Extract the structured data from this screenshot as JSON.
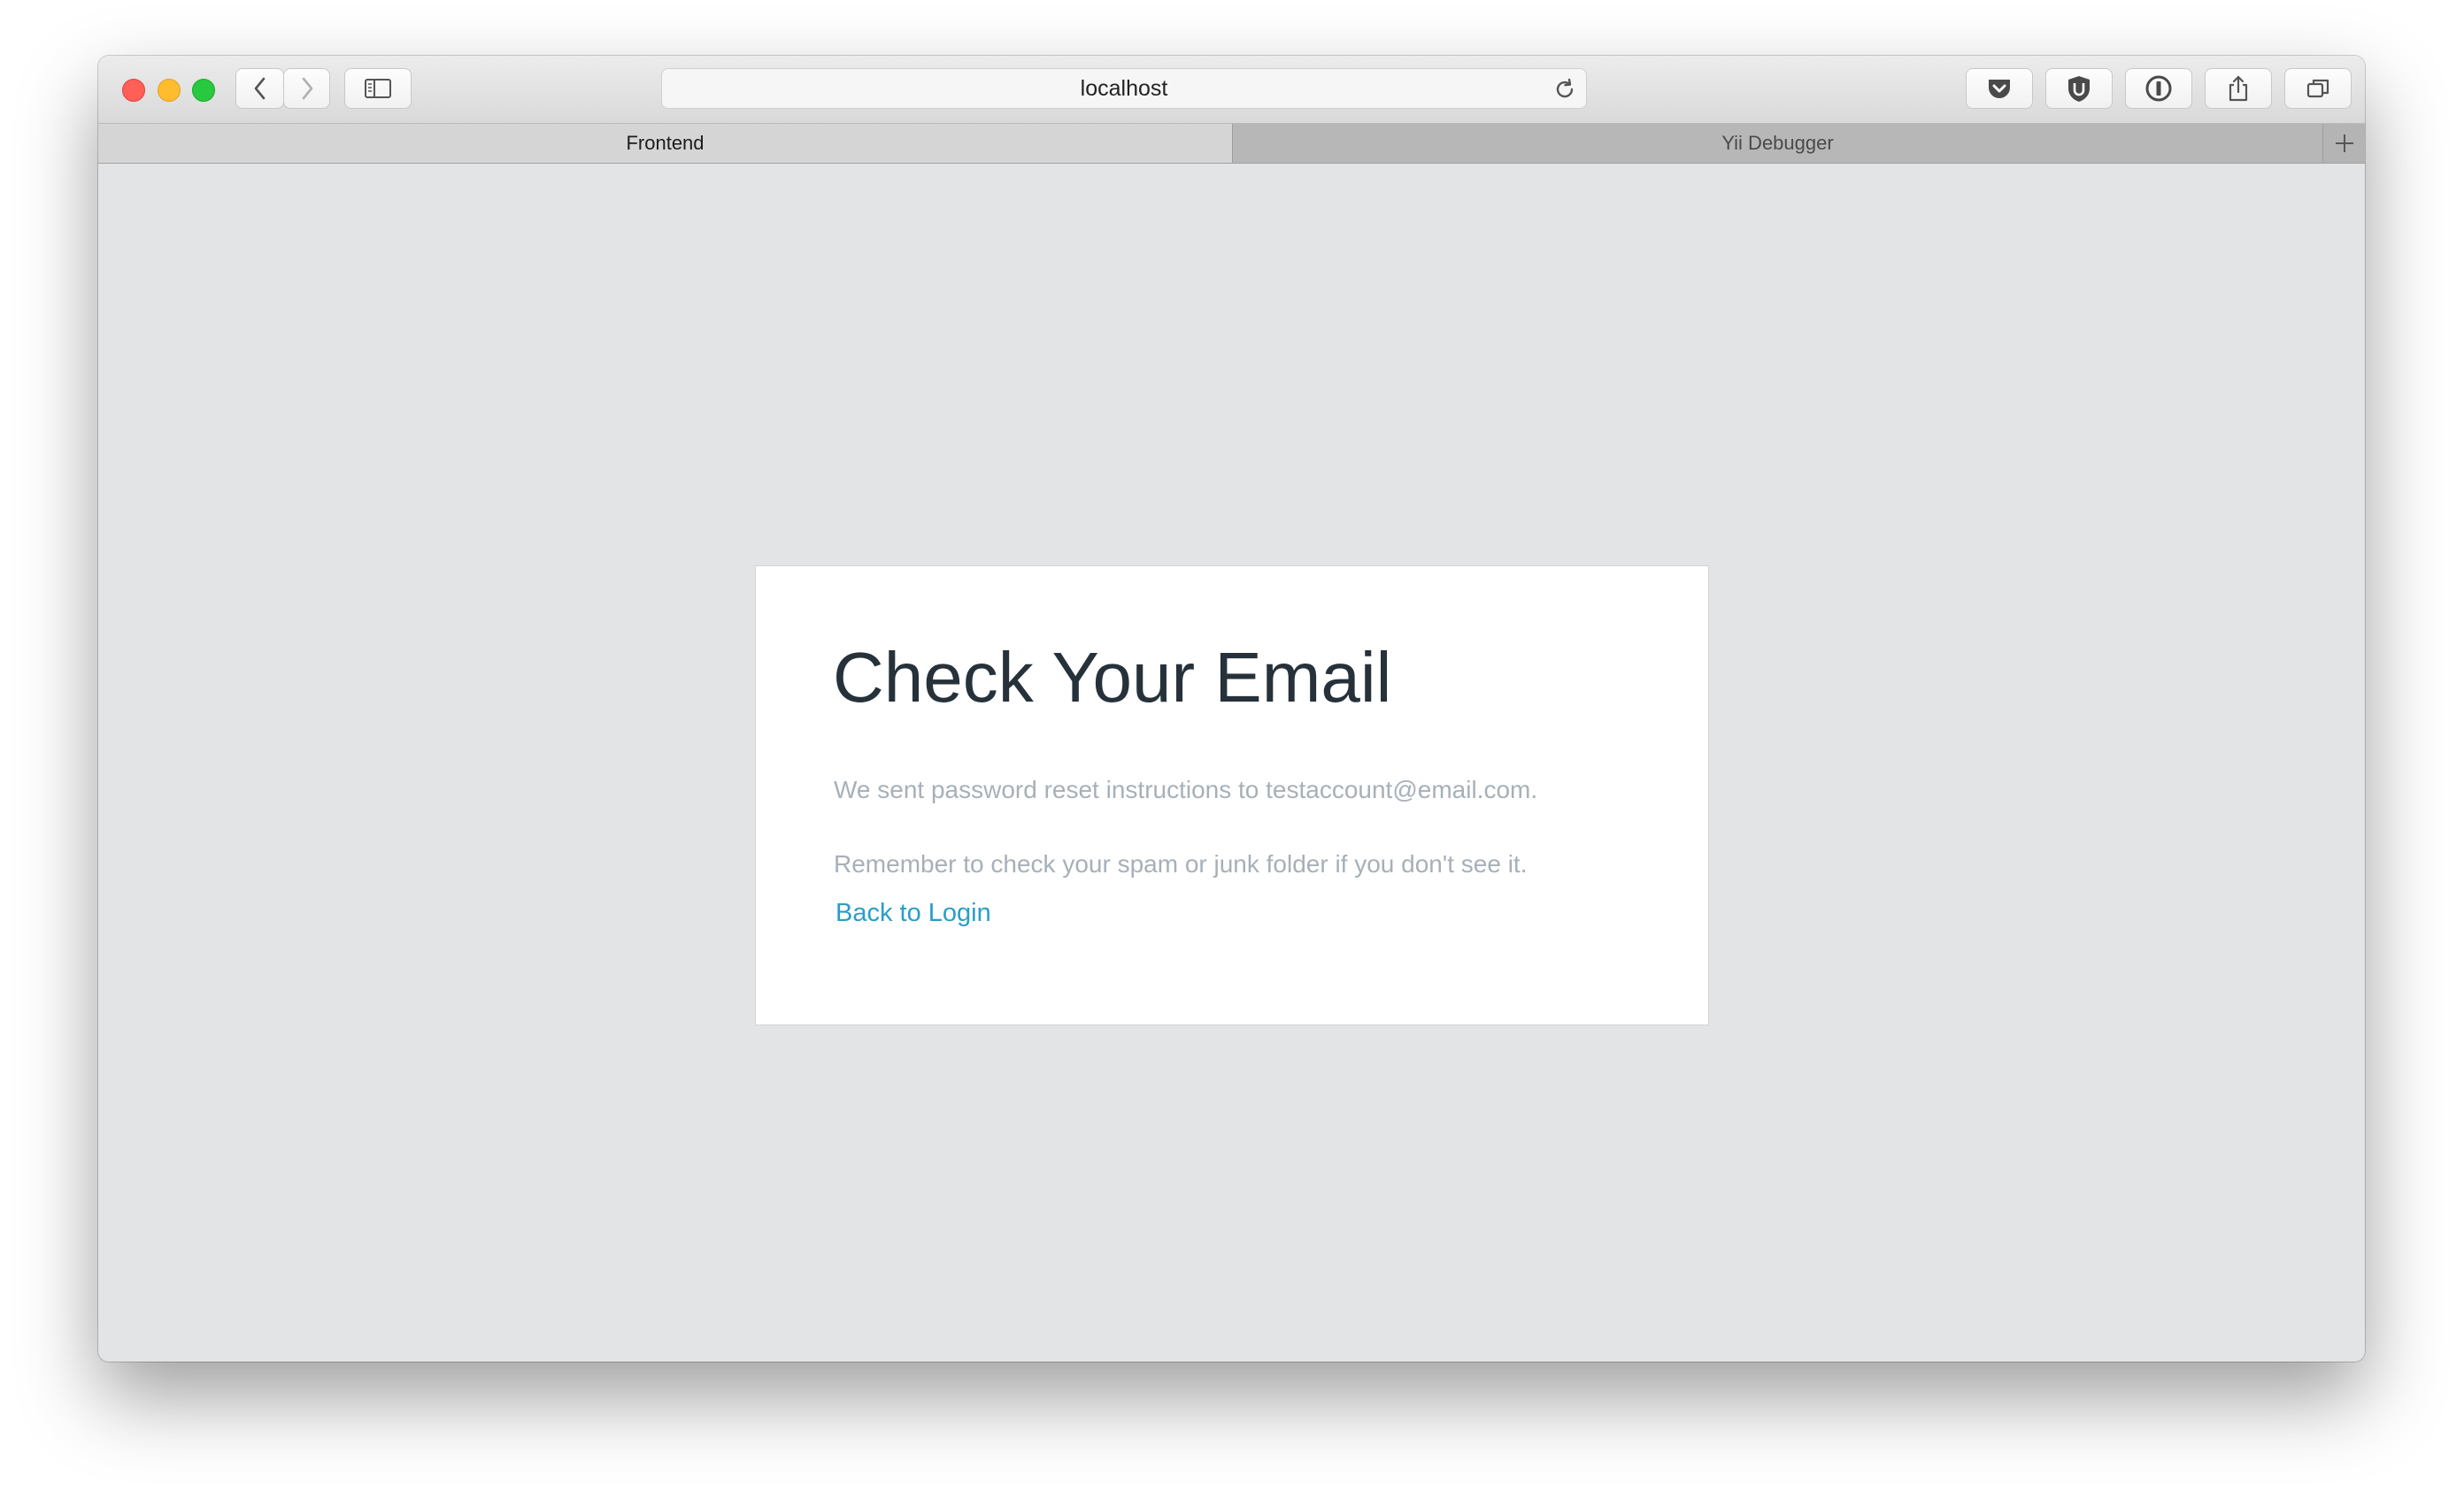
{
  "browser": {
    "address": "localhost",
    "tabs": [
      {
        "label": "Frontend",
        "active": true
      },
      {
        "label": "Yii Debugger",
        "active": false
      }
    ],
    "toolbar_icons": [
      "back-icon",
      "forward-icon",
      "sidebar-icon",
      "reload-icon",
      "pocket-icon",
      "ublock-icon",
      "onepassword-icon",
      "share-icon",
      "tabs-overview-icon",
      "new-tab-icon"
    ]
  },
  "page": {
    "title": "Check Your Email",
    "message": "We sent password reset instructions to testaccount@email.com.",
    "hint": "Remember to check your spam or junk folder if you don't see it.",
    "back_link": "Back to Login"
  },
  "colors": {
    "background": "#e3e4e6",
    "card": "#ffffff",
    "title": "#26313a",
    "muted_text": "#a7b0b8",
    "link": "#2a9ec6"
  }
}
